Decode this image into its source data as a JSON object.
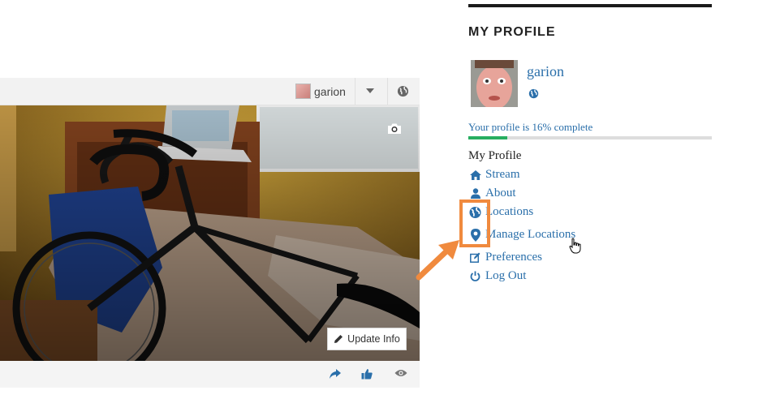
{
  "card": {
    "user_name": "garion",
    "update_button_label": "Update Info",
    "icons": {
      "globe": "globe-icon",
      "camera": "camera-icon",
      "pencil": "pencil-icon",
      "share": "share-icon",
      "like": "thumbs-up-icon",
      "view": "eye-icon"
    }
  },
  "sidebar": {
    "heading": "MY PROFILE",
    "username": "garion",
    "progress_text": "Your profile is 16% complete",
    "progress_fraction": 0.16,
    "menu_title": "My Profile",
    "menu": [
      {
        "label": "Stream",
        "icon": "home-icon"
      },
      {
        "label": "About",
        "icon": "user-icon"
      },
      {
        "label": "Locations",
        "icon": "globe-icon"
      },
      {
        "label": "Manage Locations",
        "icon": "map-pin-icon"
      },
      {
        "label": "Preferences",
        "icon": "edit-icon"
      },
      {
        "label": "Log Out",
        "icon": "power-icon"
      }
    ]
  },
  "colors": {
    "link": "#2a6faa",
    "progress": "#27ae60",
    "highlight": "#f08a3e"
  }
}
